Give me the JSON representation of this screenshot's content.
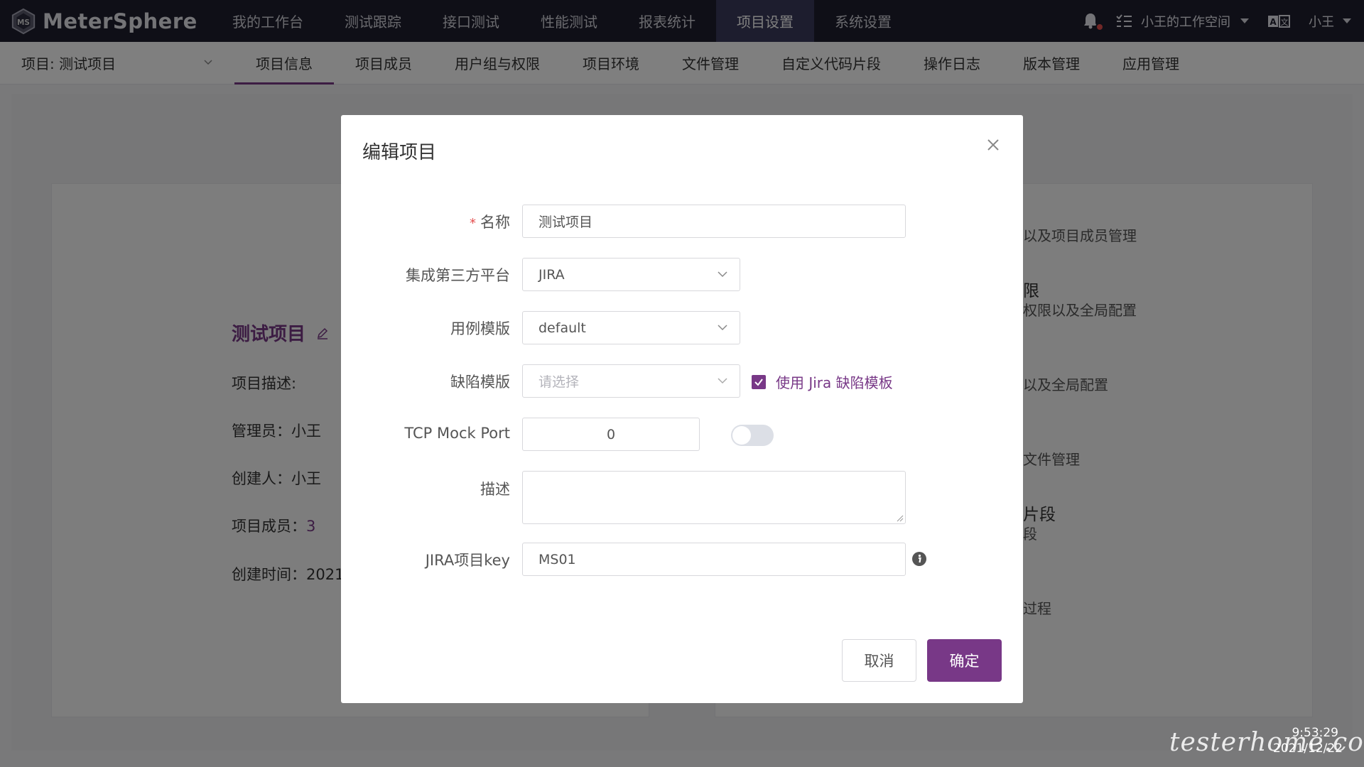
{
  "topbar": {
    "logo_text": "MeterSphere",
    "nav": [
      "我的工作台",
      "测试跟踪",
      "接口测试",
      "性能测试",
      "报表统计",
      "项目设置",
      "系统设置"
    ],
    "active_nav": "项目设置",
    "workspace": "小王的工作空间",
    "user": "小王"
  },
  "subnav": {
    "project_selector": "项目: 测试项目",
    "tabs": [
      "项目信息",
      "项目成员",
      "用户组与权限",
      "项目环境",
      "文件管理",
      "自定义代码片段",
      "操作日志",
      "版本管理",
      "应用管理"
    ],
    "active_tab": "项目信息"
  },
  "background": {
    "project_name": "测试项目",
    "description_label": "项目描述:",
    "manager": "管理员：小王",
    "creator": "创建人：小王",
    "members_label": "项目成员：",
    "members_count": "3",
    "created_time": "创建时间：2021",
    "right_lines": [
      "以及项目成员管理",
      "限",
      "权限以及全局配置",
      "以及全局配置",
      "文件管理",
      "片段",
      "段",
      "过程"
    ]
  },
  "dialog": {
    "title": "编辑项目",
    "fields": {
      "name": {
        "label": "名称",
        "value": "测试项目",
        "required": true
      },
      "platform": {
        "label": "集成第三方平台",
        "value": "JIRA"
      },
      "case_template": {
        "label": "用例模版",
        "value": "default"
      },
      "defect_template": {
        "label": "缺陷模版",
        "placeholder": "请选择"
      },
      "use_jira_template": {
        "label": "使用 Jira 缺陷模板",
        "checked": true
      },
      "tcp_mock_port": {
        "label": "TCP Mock Port",
        "value": "0",
        "toggle_on": false
      },
      "description": {
        "label": "描述",
        "value": ""
      },
      "jira_key": {
        "label": "JIRA项目key",
        "value": "MS01"
      }
    },
    "cancel_label": "取消",
    "ok_label": "确定"
  },
  "watermark": {
    "text": "testerhome.com",
    "time": "9:53:29",
    "date": "2021/12/22"
  },
  "colors": {
    "brand": "#783887",
    "topbar_bg": "#1e1f2f",
    "required": "#e44f4f"
  }
}
